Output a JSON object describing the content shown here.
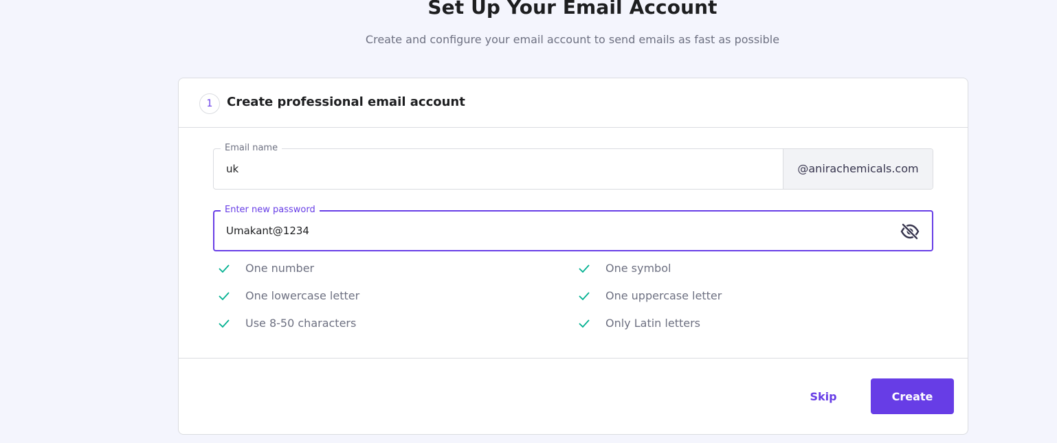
{
  "header": {
    "title": "Set Up Your Email Account",
    "subtitle": "Create and configure your email account to send emails as fast as possible"
  },
  "step": {
    "number": "1",
    "title": "Create professional email account"
  },
  "email_field": {
    "label": "Email name",
    "value": "uk",
    "domain": "@anirachemicals.com"
  },
  "password_field": {
    "label": "Enter new password",
    "value": "Umakant@1234",
    "visibility_icon": "eye-off-icon"
  },
  "requirements": [
    {
      "text": "One number",
      "met": true
    },
    {
      "text": "One symbol",
      "met": true
    },
    {
      "text": "One lowercase letter",
      "met": true
    },
    {
      "text": "One uppercase letter",
      "met": true
    },
    {
      "text": "Use 8-50 characters",
      "met": true
    },
    {
      "text": "Only Latin letters",
      "met": true
    }
  ],
  "actions": {
    "skip_label": "Skip",
    "create_label": "Create"
  },
  "colors": {
    "accent": "#673de6",
    "check": "#00b090",
    "background": "#f4f5fd"
  }
}
